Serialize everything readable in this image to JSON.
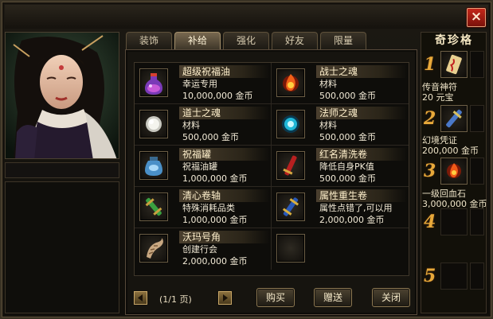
{
  "tabs": [
    {
      "label": "装饰",
      "active": false
    },
    {
      "label": "补给",
      "active": true
    },
    {
      "label": "强化",
      "active": false
    },
    {
      "label": "好友",
      "active": false
    },
    {
      "label": "限量",
      "active": false
    }
  ],
  "items": [
    {
      "name": "超级祝福油",
      "desc": "幸运专用",
      "price": "10,000,000 金币",
      "icon": "bless-oil-potion-icon"
    },
    {
      "name": "战士之魂",
      "desc": "材料",
      "price": "500,000 金币",
      "icon": "warrior-soul-flame-icon"
    },
    {
      "name": "道士之魂",
      "desc": "材料",
      "price": "500,000 金币",
      "icon": "taoist-soul-orb-icon"
    },
    {
      "name": "法师之魂",
      "desc": "材料",
      "price": "500,000 金币",
      "icon": "mage-soul-orb-icon"
    },
    {
      "name": "祝福罐",
      "desc": "祝福油罐",
      "price": "1,000,000 金币",
      "icon": "blessing-jar-icon"
    },
    {
      "name": "红名清洗卷",
      "desc": "降低自身PK值",
      "price": "500,000 金币",
      "icon": "red-scroll-icon"
    },
    {
      "name": "清心卷轴",
      "desc": "特殊消耗品类",
      "price": "1,000,000 金币",
      "icon": "green-scroll-icon"
    },
    {
      "name": "属性重生卷",
      "desc": "属性点错了,可以用",
      "price": "2,000,000 金币",
      "icon": "blue-scroll-icon"
    },
    {
      "name": "沃玛号角",
      "desc": "创建行会",
      "price": "2,000,000 金币",
      "icon": "woma-horn-icon"
    },
    {
      "name": "",
      "desc": "",
      "price": "",
      "icon": "empty-slot"
    }
  ],
  "pagination": {
    "prev_icon": "left-arrow-icon",
    "text": "(1/1 页)",
    "next_icon": "right-arrow-icon"
  },
  "buttons": {
    "buy": "购买",
    "gift": "赠送",
    "close": "关闭"
  },
  "close_icon": "×",
  "treasure": {
    "title": "奇珍格",
    "entries": [
      {
        "rank": "1",
        "name": "传音神符",
        "price": "20 元宝",
        "icon": "talisman-icon"
      },
      {
        "rank": "2",
        "name": "幻境凭证",
        "price": "200,000 金币",
        "icon": "voucher-scroll-icon"
      },
      {
        "rank": "3",
        "name": "一级回血石",
        "price": "3,000,000 金币",
        "icon": "healing-stone-icon"
      },
      {
        "rank": "4",
        "name": "",
        "price": "",
        "icon": "empty-slot"
      },
      {
        "rank": "5",
        "name": "",
        "price": "",
        "icon": "empty-slot"
      }
    ]
  },
  "colors": {
    "accent_gold": "#e8a93a",
    "close_red": "#c4271a",
    "text": "#f2ead6"
  }
}
